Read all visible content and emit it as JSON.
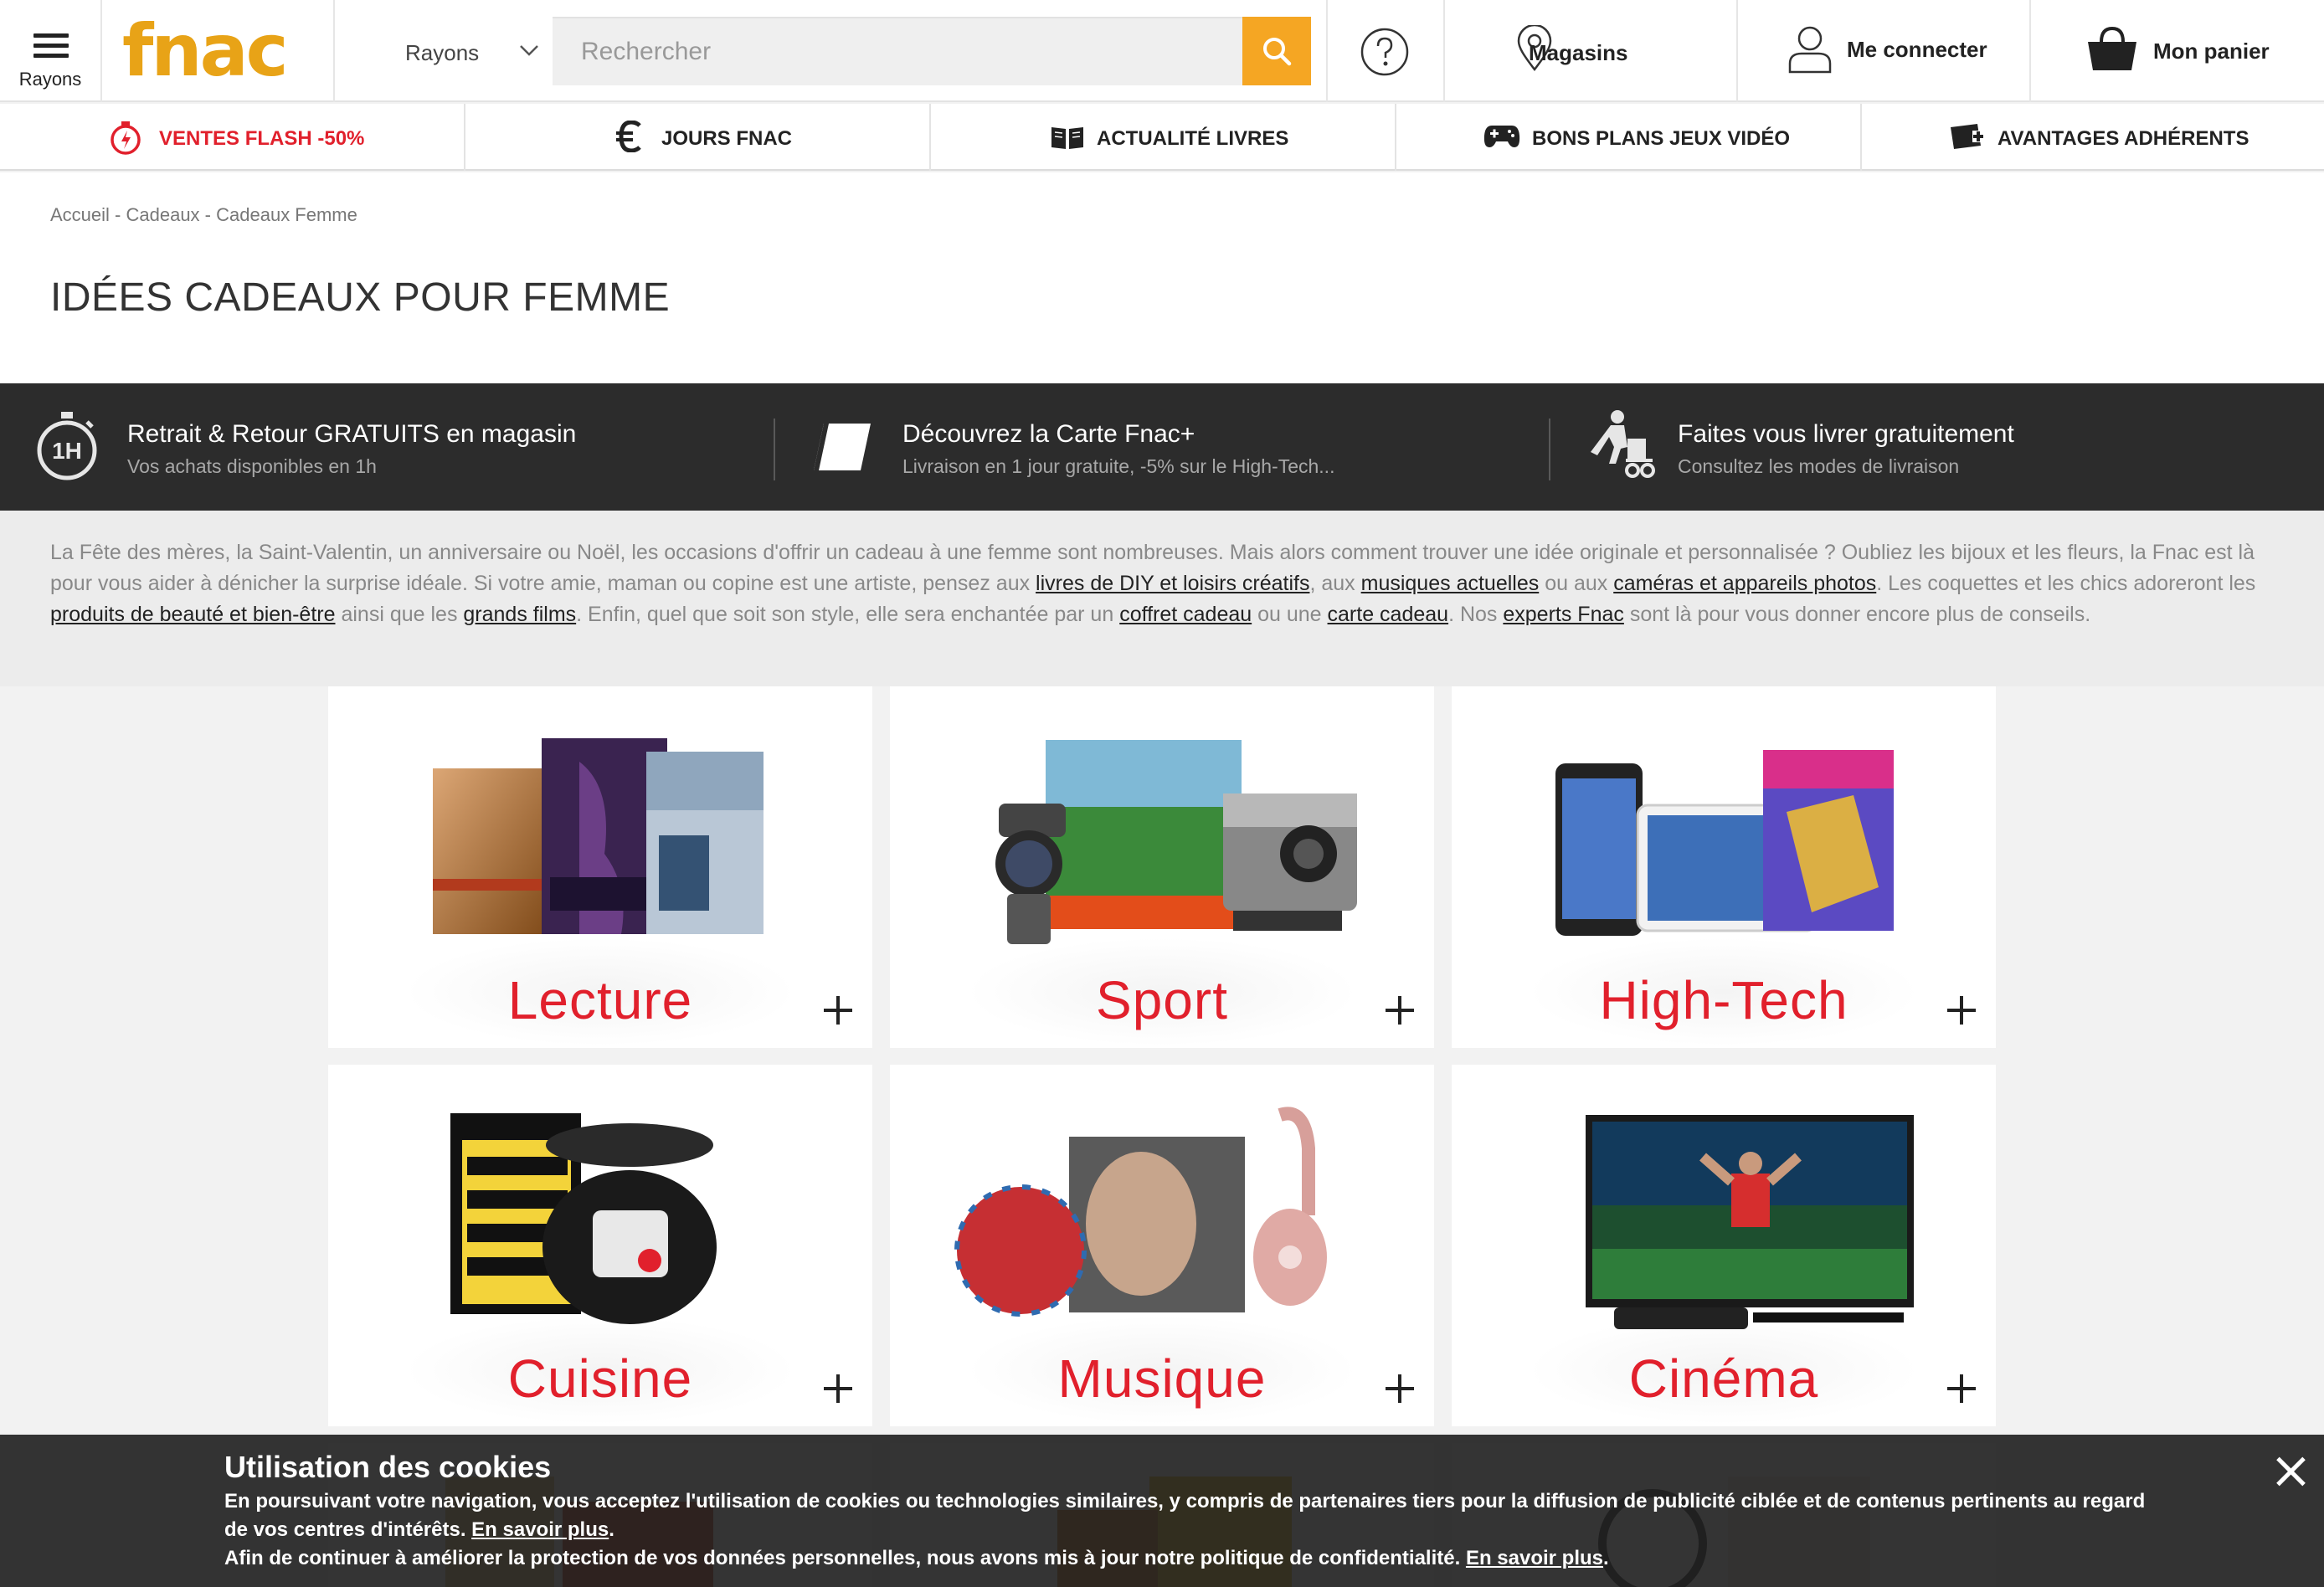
{
  "header": {
    "menu_label": "Rayons",
    "logo_text": "fnac",
    "search_category": "Rayons",
    "search_placeholder": "Rechercher",
    "stores_label": "Magasins",
    "login_label": "Me connecter",
    "cart_label": "Mon panier"
  },
  "catnav": [
    {
      "label": "VENTES FLASH -50%",
      "icon": "stopwatch-icon"
    },
    {
      "label": "JOURS FNAC",
      "icon": "euro-icon"
    },
    {
      "label": "ACTUALITÉ LIVRES",
      "icon": "book-icon"
    },
    {
      "label": "BONS PLANS JEUX VIDÉO",
      "icon": "gamepad-icon"
    },
    {
      "label": "AVANTAGES ADHÉRENTS",
      "icon": "card-plus-icon"
    }
  ],
  "breadcrumb": [
    "Accueil",
    "Cadeaux",
    "Cadeaux Femme"
  ],
  "breadcrumb_sep": " - ",
  "page_title": "IDÉES CADEAUX POUR FEMME",
  "services": [
    {
      "title": "Retrait & Retour GRATUITS en magasin",
      "subtitle": "Vos achats disponibles en 1h",
      "icon": "1h-timer-icon"
    },
    {
      "title": "Découvrez la Carte Fnac+",
      "subtitle": "Livraison en 1 jour gratuite, -5% sur le High-Tech...",
      "icon": "card-icon"
    },
    {
      "title": "Faites vous livrer gratuitement",
      "subtitle": "Consultez les modes de livraison",
      "icon": "delivery-icon"
    }
  ],
  "intro": {
    "t1": "La Fête des mères, la Saint-Valentin, un anniversaire ou Noël, les occasions d'offrir un cadeau à une femme sont nombreuses. Mais alors comment trouver une idée originale et personnalisée ? Oubliez les bijoux et les fleurs, la Fnac est là pour vous aider à dénicher la surprise idéale. Si votre amie, maman ou copine est une artiste, pensez aux ",
    "l1": "livres de DIY et loisirs créatifs",
    "t2": ", aux ",
    "l2": "musiques actuelles",
    "t3": " ou aux ",
    "l3": "caméras et appareils photos",
    "t4": ". Les coquettes et les chics adoreront les ",
    "l4": "produits de beauté et bien-être",
    "t5": " ainsi que les ",
    "l5": "grands films",
    "t6": ". Enfin, quel que soit son style, elle sera enchantée par un ",
    "l6": "coffret cadeau",
    "t7": " ou une ",
    "l7": "carte cadeau",
    "t8": ". Nos ",
    "l8": "experts Fnac",
    "t9": " sont là pour vous donner encore plus de conseils."
  },
  "tiles": [
    {
      "name": "Lecture"
    },
    {
      "name": "Sport"
    },
    {
      "name": "High-Tech"
    },
    {
      "name": "Cuisine"
    },
    {
      "name": "Musique"
    },
    {
      "name": "Cinéma"
    }
  ],
  "cookie": {
    "title": "Utilisation des cookies",
    "line1": "En poursuivant votre navigation, vous acceptez l'utilisation de cookies ou technologies similaires, y compris de partenaires tiers pour la diffusion de publicité ciblée et de contenus pertinents au regard",
    "line2": "de vos centres d'intérêts. ",
    "link1": "En savoir plus",
    "line2_end": ".",
    "line3": "Afin de continuer à améliorer la protection de vos données personnelles, nous avons mis à jour notre politique de confidentialité. ",
    "link2": "En savoir plus",
    "line3_end": "."
  },
  "colors": {
    "brand_yellow": "#f5a623",
    "accent_red": "#e1202c",
    "dark_band": "#2c2c2c"
  }
}
